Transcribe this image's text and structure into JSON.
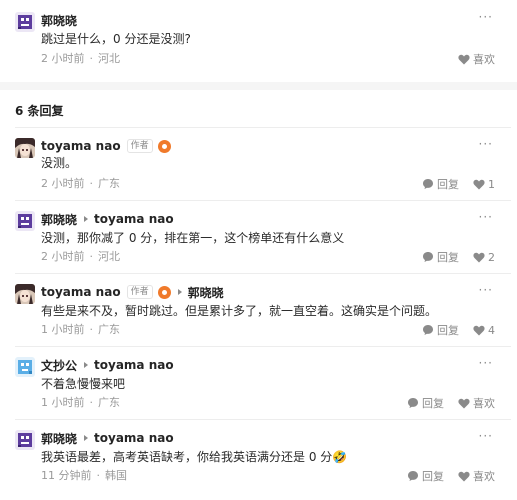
{
  "main_comment": {
    "user": "郭晓晓",
    "text": "跳过是什么，0 分还是没测?",
    "time": "2 小时前",
    "location": "河北",
    "like_label": "喜欢",
    "avatar_icon": "purple-pixel-avatar"
  },
  "replies_header": "6 条回复",
  "replies": [
    {
      "user": "toyama nao",
      "author_tag": "作者",
      "reply_to": "",
      "text": "没测。",
      "time": "2 小时前",
      "location": "广东",
      "reply_label": "回复",
      "like_label": "1",
      "avatar_icon": "anime-girl-avatar"
    },
    {
      "user": "郭晓晓",
      "author_tag": "",
      "reply_to": "toyama nao",
      "text": "没测，那你减了 0 分，排在第一，这个榜单还有什么意义",
      "time": "2 小时前",
      "location": "河北",
      "reply_label": "回复",
      "like_label": "2",
      "avatar_icon": "purple-pixel-avatar"
    },
    {
      "user": "toyama nao",
      "author_tag": "作者",
      "reply_to": "郭晓晓",
      "text": "有些是来不及，暂时跳过。但是累计多了，就一直空着。这确实是个问题。",
      "time": "1 小时前",
      "location": "广东",
      "reply_label": "回复",
      "like_label": "4",
      "avatar_icon": "anime-girl-avatar"
    },
    {
      "user": "文抄公",
      "author_tag": "",
      "reply_to": "toyama nao",
      "text": "不着急慢慢来吧",
      "time": "1 小时前",
      "location": "广东",
      "reply_label": "回复",
      "like_label": "喜欢",
      "avatar_icon": "blue-pixel-avatar"
    },
    {
      "user": "郭晓晓",
      "author_tag": "",
      "reply_to": "toyama nao",
      "text": "我英语最差，高考英语缺考，你给我英语满分还是 0 分🤣",
      "time": "11 分钟前",
      "location": "韩国",
      "reply_label": "回复",
      "like_label": "喜欢",
      "avatar_icon": "purple-pixel-avatar"
    }
  ],
  "colors": {
    "name": "#252525",
    "meta": "#9a9a9a",
    "icon": "#8a8a8a",
    "badge": "#f07a2b",
    "divider": "#f5f5f5"
  }
}
